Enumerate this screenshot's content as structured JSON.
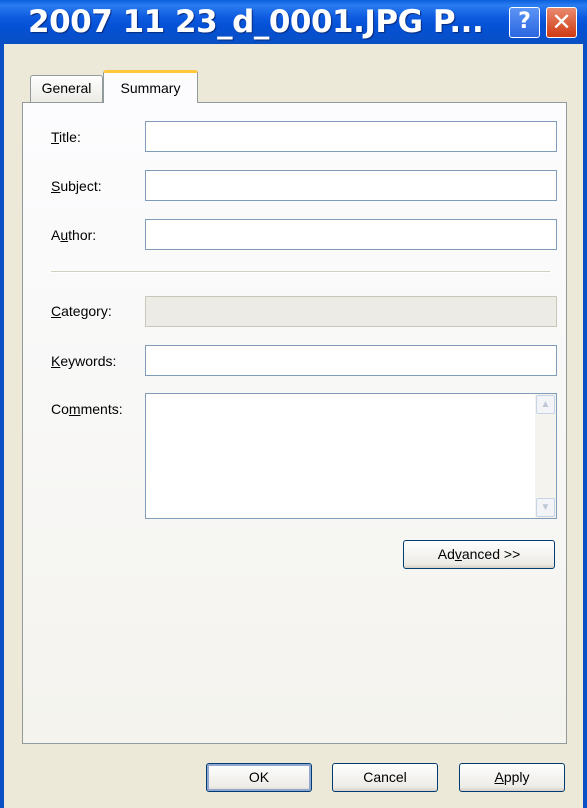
{
  "window": {
    "title": "2007 11 23_d_0001.JPG P..."
  },
  "titlebar_buttons": {
    "help": "?",
    "close": "✕"
  },
  "tabs": [
    {
      "label": "General",
      "selected": false
    },
    {
      "label": "Summary",
      "selected": true
    }
  ],
  "form": {
    "title": {
      "label_pre": "",
      "label_u": "T",
      "label_post": "itle:",
      "value": ""
    },
    "subject": {
      "label_pre": "",
      "label_u": "S",
      "label_post": "ubject:",
      "value": ""
    },
    "author": {
      "label_pre": "A",
      "label_u": "u",
      "label_post": "thor:",
      "value": ""
    },
    "category": {
      "label_pre": "",
      "label_u": "C",
      "label_post": "ategory:",
      "value": "",
      "disabled": true
    },
    "keywords": {
      "label_pre": "",
      "label_u": "K",
      "label_post": "eywords:",
      "value": ""
    },
    "comments": {
      "label_pre": "Co",
      "label_u": "m",
      "label_post": "ments:",
      "value": ""
    }
  },
  "advanced_button": {
    "pre": "Ad",
    "u": "v",
    "post": "anced >>"
  },
  "footer": {
    "ok": "OK",
    "cancel": "Cancel",
    "apply_u": "A",
    "apply_post": "pply"
  },
  "colors": {
    "titlebar": "#0451d6",
    "face": "#ece9d8",
    "tab_highlight": "#ffc83c"
  }
}
